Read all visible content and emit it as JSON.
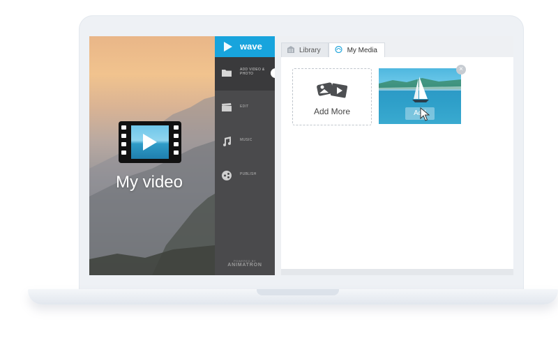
{
  "preview": {
    "title": "My video",
    "film_icon": "film-play-icon"
  },
  "sidebar": {
    "logo_text": "wave",
    "items": [
      {
        "label": "ADD VIDEO & PHOTO",
        "icon": "folder-icon"
      },
      {
        "label": "EDIT",
        "icon": "clapperboard-icon"
      },
      {
        "label": "MUSIC",
        "icon": "music-note-icon"
      },
      {
        "label": "PUBLISH",
        "icon": "share-icon"
      }
    ],
    "powered_small": "POWERED BY",
    "powered_brand": "ANIMATRON"
  },
  "tabs": [
    {
      "label": "Library",
      "icon": "library-icon"
    },
    {
      "label": "My Media",
      "icon": "cloud-icon"
    }
  ],
  "media": {
    "add_more_label": "Add More",
    "thumb_button_label": "Add",
    "close_symbol": "×"
  },
  "colors": {
    "accent": "#18a4dd",
    "sidebar": "#4a4a4c"
  }
}
